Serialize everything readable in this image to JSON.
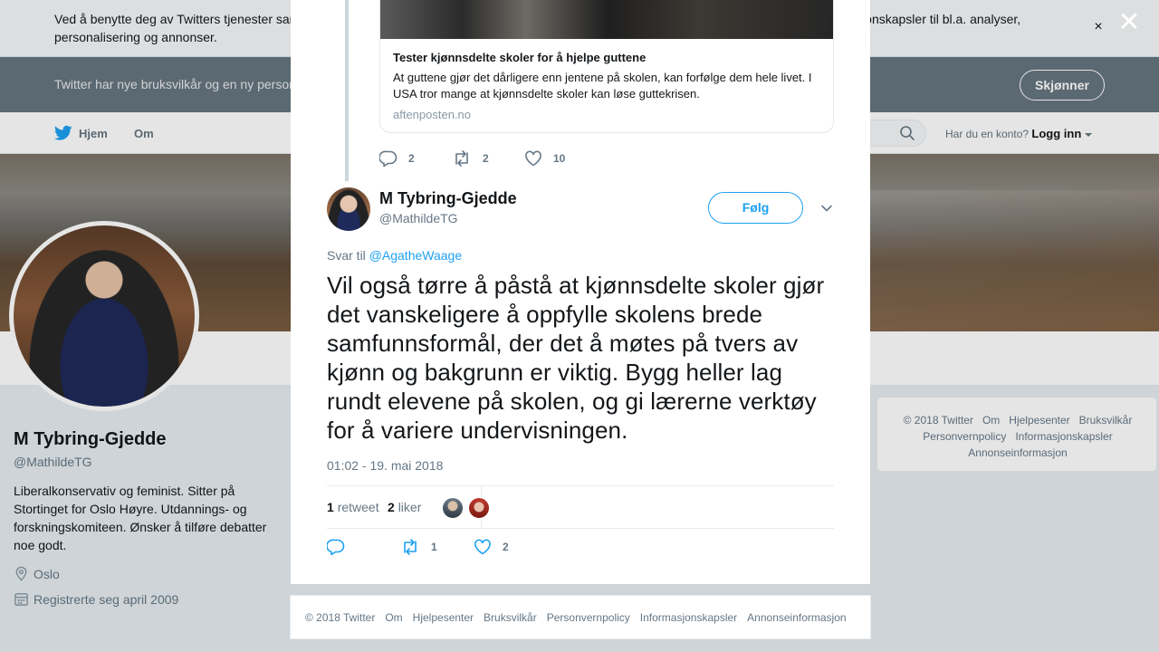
{
  "cookie_banner": {
    "text": "Ved å benytte deg av Twitters tjenester samtykker du til vår bruk av informasjonskapsler. Vi og våre partnere opererer globalt og bruker informasjonskapsler til bl.a. analyser, personalisering og annonser.",
    "close_glyph": "×"
  },
  "terms_banner": {
    "text": "Twitter har nye bruksvilkår og en ny personvernpolicy",
    "button": "Skjønner"
  },
  "nav": {
    "home": "Hjem",
    "about": "Om",
    "login_prompt": "Har du en konto?",
    "login_link": "Logg inn"
  },
  "profile": {
    "name": "M Tybring-Gjedde",
    "handle": "@MathildeTG",
    "bio": "Liberalkonservativ og feminist. Sitter på Stortinget for Oslo Høyre. Utdannings- og forskningskomiteen. Ønsker å tilføre debatter noe godt.",
    "location": "Oslo",
    "joined": "Registrerte seg april 2009"
  },
  "side_footer": {
    "links": [
      "© 2018 Twitter",
      "Om",
      "Hjelpesenter",
      "Bruksvilkår",
      "Personvernpolicy",
      "Informasjonskapsler",
      "Annonseinformasjon"
    ]
  },
  "overlay": {
    "close_glyph": "✕"
  },
  "link_card": {
    "title": "Tester kjønnsdelte skoler for å hjelpe guttene",
    "description": "At guttene gjør det dårligere enn jentene på skolen, kan forfølge dem hele livet. I USA tror mange at kjønnsdelte skoler kan løse guttekrisen.",
    "domain": "aftenposten.no"
  },
  "previous_tweet_actions": {
    "replies": "2",
    "retweets": "2",
    "likes": "10"
  },
  "tweet": {
    "name": "M Tybring-Gjedde",
    "handle": "@MathildeTG",
    "follow_label": "Følg",
    "reply_prefix": "Svar til",
    "reply_handle": "@AgatheWaage",
    "text": "Vil også tørre å påstå at kjønnsdelte skoler gjør det vanskeligere å oppfylle skolens brede samfunnsformål, der det å møtes på tvers av kjønn og bakgrunn er viktig. Bygg heller lag rundt elevene på skolen, og gi lærerne verktøy for å variere undervisningen.",
    "timestamp": "01:02 - 19. mai 2018",
    "retweet_count": "1",
    "retweet_label": "retweet",
    "like_count": "2",
    "like_label": "liker",
    "actions": {
      "retweets": "1",
      "likes": "2"
    }
  },
  "modal_footer": {
    "links": [
      "© 2018 Twitter",
      "Om",
      "Hjelpesenter",
      "Bruksvilkår",
      "Personvernpolicy",
      "Informasjonskapsler",
      "Annonseinformasjon"
    ]
  },
  "colors": {
    "accent": "#1da1f2",
    "text": "#14171a",
    "muted": "#657786"
  }
}
